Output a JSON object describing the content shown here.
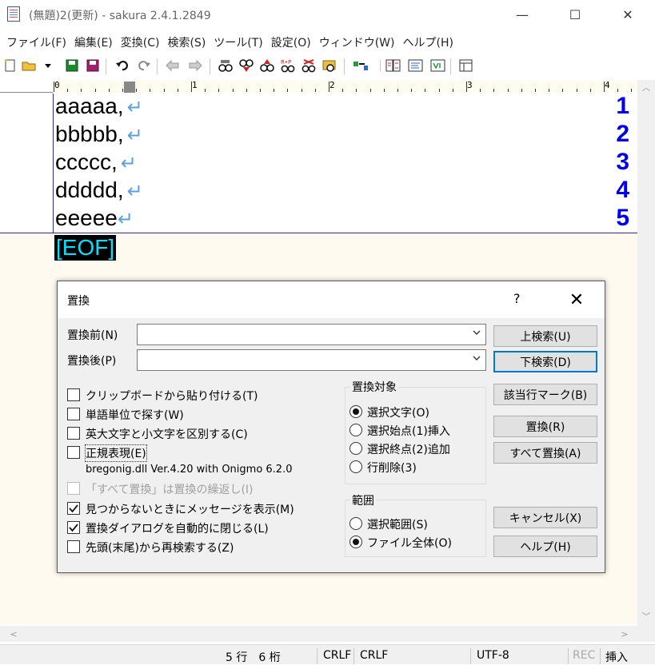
{
  "window": {
    "title": "(無題)2(更新) - sakura 2.4.1.2849",
    "minimize": "—",
    "maximize": "☐",
    "close": "✕"
  },
  "menu": [
    "ファイル(F)",
    "編集(E)",
    "変換(C)",
    "検索(S)",
    "ツール(T)",
    "設定(O)",
    "ウィンドウ(W)",
    "ヘルプ(H)"
  ],
  "ruler": {
    "labels": [
      "0",
      "1",
      "2",
      "3",
      "4"
    ]
  },
  "editor": {
    "lines": [
      {
        "num": "1",
        "text": "aaaaa,"
      },
      {
        "num": "2",
        "text": "bbbbb,"
      },
      {
        "num": "3",
        "text": "ccccc,"
      },
      {
        "num": "4",
        "text": "ddddd,"
      },
      {
        "num": "5",
        "text": "eeeee"
      }
    ],
    "linefeed_glyph": "↵",
    "eof": "[EOF]"
  },
  "dialog": {
    "title": "置換",
    "help": "?",
    "close": "✕",
    "find_label": "置換前(N)",
    "find_value": "",
    "replace_label": "置換後(P)",
    "replace_value": "",
    "options": [
      {
        "label": "クリップボードから貼り付ける(T)",
        "checked": false,
        "disabled": false
      },
      {
        "label": "単語単位で探す(W)",
        "checked": false,
        "disabled": false
      },
      {
        "label": "英大文字と小文字を区別する(C)",
        "checked": false,
        "disabled": false
      },
      {
        "label": "正規表現(E)",
        "checked": false,
        "disabled": false
      },
      {
        "label": "「すべて置換」は置換の繰返し(I)",
        "checked": false,
        "disabled": true
      },
      {
        "label": "見つからないときにメッセージを表示(M)",
        "checked": true,
        "disabled": false
      },
      {
        "label": "置換ダイアログを自動的に閉じる(L)",
        "checked": true,
        "disabled": false
      },
      {
        "label": "先頭(末尾)から再検索する(Z)",
        "checked": false,
        "disabled": false
      }
    ],
    "regex_info": "bregonig.dll Ver.4.20 with Onigmo 6.2.0",
    "target_group": "置換対象",
    "targets": [
      {
        "label": "選択文字(O)",
        "selected": true
      },
      {
        "label": "選択始点(1)挿入",
        "selected": false
      },
      {
        "label": "選択終点(2)追加",
        "selected": false
      },
      {
        "label": "行削除(3)",
        "selected": false
      }
    ],
    "scope_group": "範囲",
    "scopes": [
      {
        "label": "選択範囲(S)",
        "selected": false
      },
      {
        "label": "ファイル全体(O)",
        "selected": true
      }
    ],
    "buttons": {
      "search_up": "上検索(U)",
      "search_down": "下検索(D)",
      "mark": "該当行マーク(B)",
      "replace": "置換(R)",
      "replace_all": "すべて置換(A)",
      "cancel": "キャンセル(X)",
      "help": "ヘルプ(H)"
    }
  },
  "status": {
    "position": "5 行　6 桁",
    "eol1": "CRLF",
    "eol2": "CRLF",
    "encoding": "UTF-8",
    "rec": "REC",
    "mode": "挿入"
  }
}
